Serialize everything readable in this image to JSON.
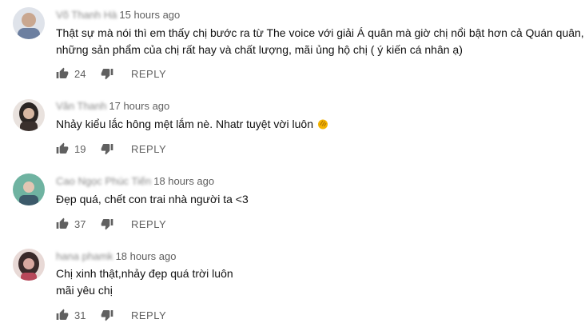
{
  "comments": [
    {
      "author": "Võ Thanh Hà",
      "time": "15 hours ago",
      "lines": [
        "Thật sự mà nói thì em thấy chị bước ra từ The voice với giải Á quân mà giờ chị nổi bật hơn cả Quán quân,",
        "những sản phẩm của chị rất hay và chất lượng, mãi ủng hộ chị ( ý kiến cá nhân ạ)"
      ],
      "likes": "24",
      "reply_label": "REPLY",
      "avatar_colors": [
        "#6c7fa0",
        "#c9a790"
      ]
    },
    {
      "author": "Văn Thanh",
      "time": "17 hours ago",
      "lines": [
        "Nhảy kiểu lắc hông mệt lắm nè. Nhatr tuyệt vời luôn"
      ],
      "emoji": "clapping-hands-icon",
      "likes": "19",
      "reply_label": "REPLY",
      "avatar_colors": [
        "#2b2523",
        "#d7b7a2"
      ]
    },
    {
      "author": "Cao Ngọc Phúc Tiến",
      "time": "18 hours ago",
      "lines": [
        "Đẹp quá, chết con trai nhà người ta <3"
      ],
      "likes": "37",
      "reply_label": "REPLY",
      "avatar_colors": [
        "#6fb3a1",
        "#3c5a6a"
      ]
    },
    {
      "author": "hana phamk",
      "time": "18 hours ago",
      "lines": [
        "Chị xinh thật,nhảy đẹp quá trời luôn",
        "mãi yêu chị"
      ],
      "likes": "31",
      "reply_label": "REPLY",
      "avatar_colors": [
        "#3a2a2a",
        "#d9a8a0"
      ]
    }
  ]
}
